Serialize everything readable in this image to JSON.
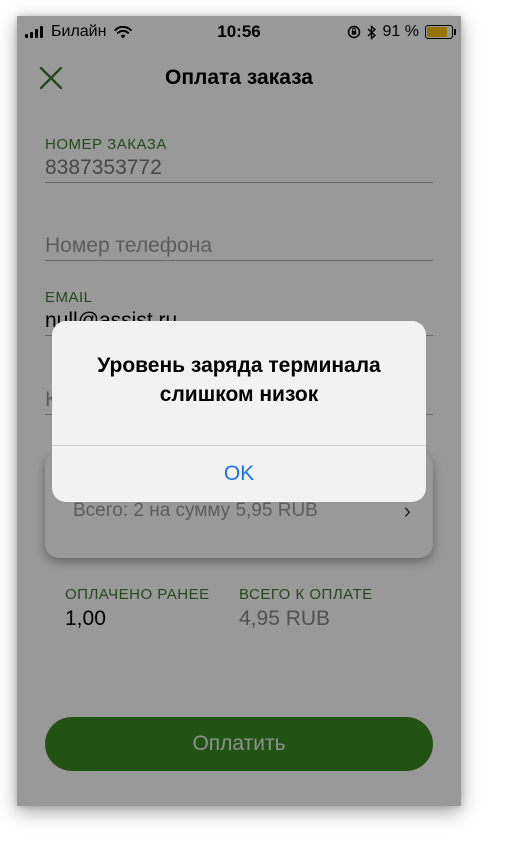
{
  "status_bar": {
    "carrier": "Билайн",
    "time": "10:56",
    "battery_text": "91 %",
    "battery_level": 0.91,
    "battery_color": "#f5c400"
  },
  "header": {
    "title": "Оплата заказа",
    "close_icon": "close-x-icon"
  },
  "form": {
    "order_number": {
      "label": "НОМЕР ЗАКАЗА",
      "value": "8387353772"
    },
    "phone": {
      "placeholder": "Номер телефона"
    },
    "email": {
      "label": "EMAIL",
      "value": "null@assist.ru"
    },
    "card_field": {
      "value": "К"
    }
  },
  "order_card": {
    "summary": "Всего: 2 на сумму 5,95 RUB",
    "chevron_icon": "chevron-right-icon"
  },
  "totals": {
    "paid_label": "ОПЛАЧЕНО РАНЕЕ",
    "paid_value": "1,00",
    "total_label": "ВСЕГО К ОПЛАТЕ",
    "total_value": "4,95 RUB"
  },
  "pay_button": {
    "label": "Оплатить"
  },
  "alert": {
    "title": "Уровень заряда терминала слишком низок",
    "ok_label": "OK"
  },
  "colors": {
    "accent_green": "#3c7a2d",
    "button_green": "#3a8a22",
    "link_blue": "#1a73e8"
  }
}
